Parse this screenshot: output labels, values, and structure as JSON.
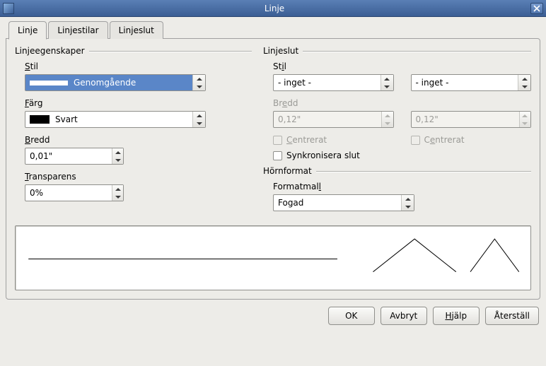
{
  "window": {
    "title": "Linje"
  },
  "tabs": [
    {
      "label": "Linje",
      "active": true
    },
    {
      "label": "Linjestilar",
      "active": false
    },
    {
      "label": "Linjeslut",
      "active": false
    }
  ],
  "left": {
    "group_title": "Linjeegenskaper",
    "style_label": "Stil",
    "style_value": "Genomgående",
    "color_label": "Färg",
    "color_value": "Svart",
    "color_hex": "#000000",
    "width_label": "Bredd",
    "width_value": "0,01\"",
    "transparency_label": "Transparens",
    "transparency_value": "0%"
  },
  "right": {
    "group_title": "Linjeslut",
    "style_label": "Stil",
    "style_left": "- inget -",
    "style_right": "- inget -",
    "width_label": "Bredd",
    "width_left": "0,12\"",
    "width_right": "0,12\"",
    "centered_label": "Centrerat",
    "sync_label": "Synkronisera slut"
  },
  "corner": {
    "group_title": "Hörnformat",
    "format_label": "Formatmall",
    "format_value": "Fogad"
  },
  "buttons": {
    "ok": "OK",
    "cancel": "Avbryt",
    "help": "Hjälp",
    "reset": "Återställ"
  }
}
